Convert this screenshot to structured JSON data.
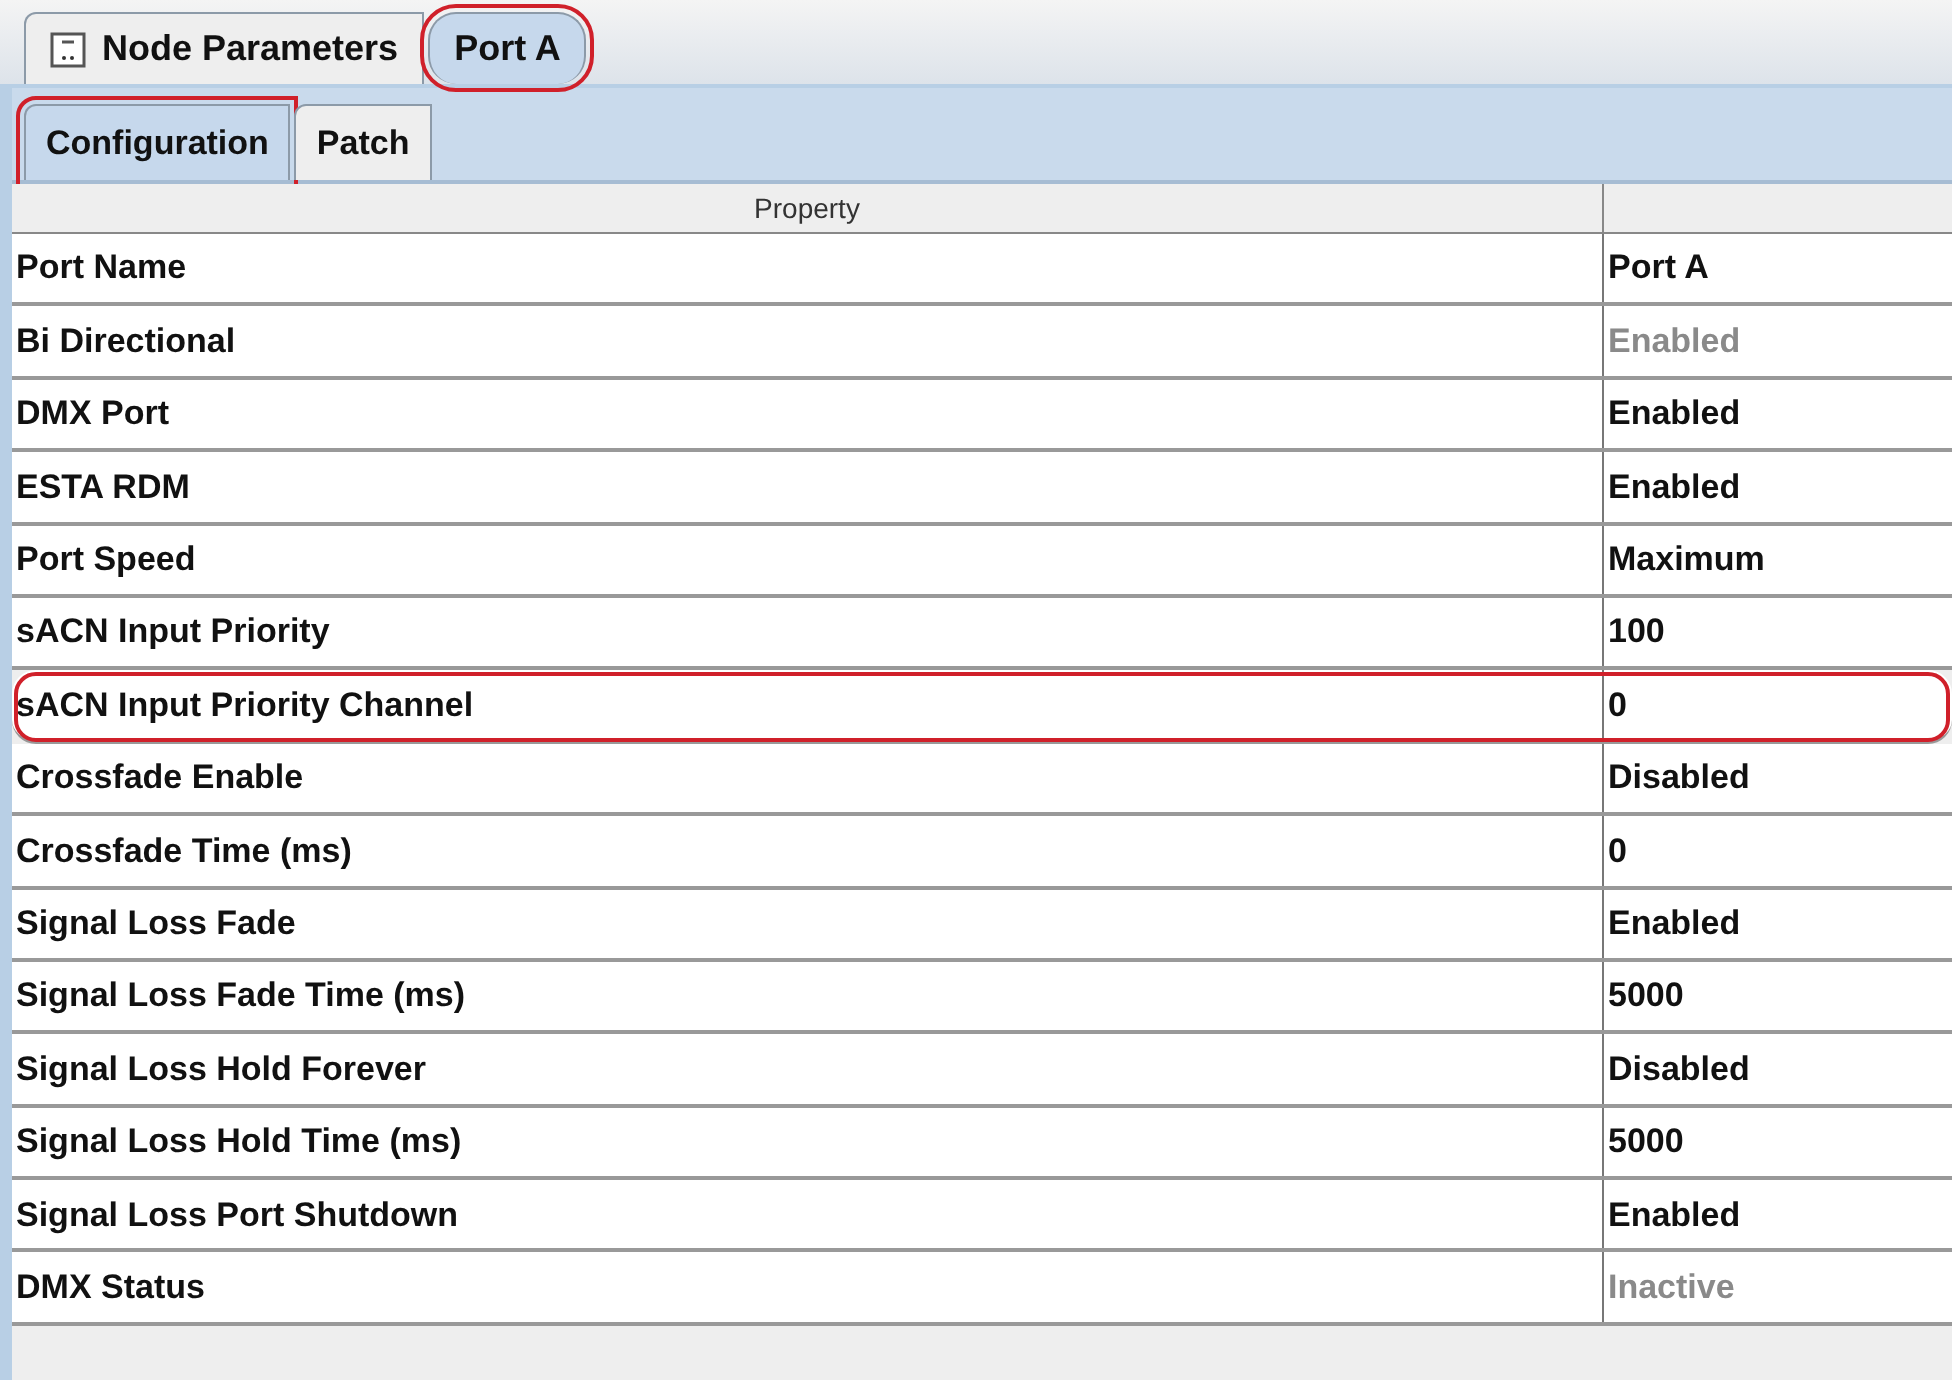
{
  "top_tabs": [
    {
      "label": "Node Parameters",
      "selected": false,
      "highlighted": false,
      "icon": true
    },
    {
      "label": "Port A",
      "selected": true,
      "highlighted": true,
      "icon": false
    }
  ],
  "sub_tabs": [
    {
      "label": "Configuration",
      "selected": true,
      "highlighted": true
    },
    {
      "label": "Patch",
      "selected": false,
      "highlighted": false
    }
  ],
  "table": {
    "columns": [
      "Property"
    ],
    "rows": [
      {
        "property": "Port Name",
        "value": "Port A",
        "disabled": false,
        "highlighted": false
      },
      {
        "property": "Bi Directional",
        "value": "Enabled",
        "disabled": true,
        "highlighted": false
      },
      {
        "property": "DMX Port",
        "value": "Enabled",
        "disabled": false,
        "highlighted": false
      },
      {
        "property": "ESTA RDM",
        "value": "Enabled",
        "disabled": false,
        "highlighted": false
      },
      {
        "property": "Port Speed",
        "value": "Maximum",
        "disabled": false,
        "highlighted": false
      },
      {
        "property": "sACN Input Priority",
        "value": "100",
        "disabled": false,
        "highlighted": false
      },
      {
        "property": "sACN Input Priority Channel",
        "value": "0",
        "disabled": false,
        "highlighted": true
      },
      {
        "property": "Crossfade Enable",
        "value": "Disabled",
        "disabled": false,
        "highlighted": false
      },
      {
        "property": "Crossfade Time (ms)",
        "value": "0",
        "disabled": false,
        "highlighted": false
      },
      {
        "property": "Signal Loss Fade",
        "value": "Enabled",
        "disabled": false,
        "highlighted": false
      },
      {
        "property": "Signal Loss Fade Time (ms)",
        "value": "5000",
        "disabled": false,
        "highlighted": false
      },
      {
        "property": "Signal Loss Hold Forever",
        "value": "Disabled",
        "disabled": false,
        "highlighted": false
      },
      {
        "property": "Signal Loss Hold Time (ms)",
        "value": "5000",
        "disabled": false,
        "highlighted": false
      },
      {
        "property": "Signal Loss Port Shutdown",
        "value": "Enabled",
        "disabled": false,
        "highlighted": false
      },
      {
        "property": "DMX Status",
        "value": "Inactive",
        "disabled": true,
        "highlighted": false
      }
    ]
  }
}
